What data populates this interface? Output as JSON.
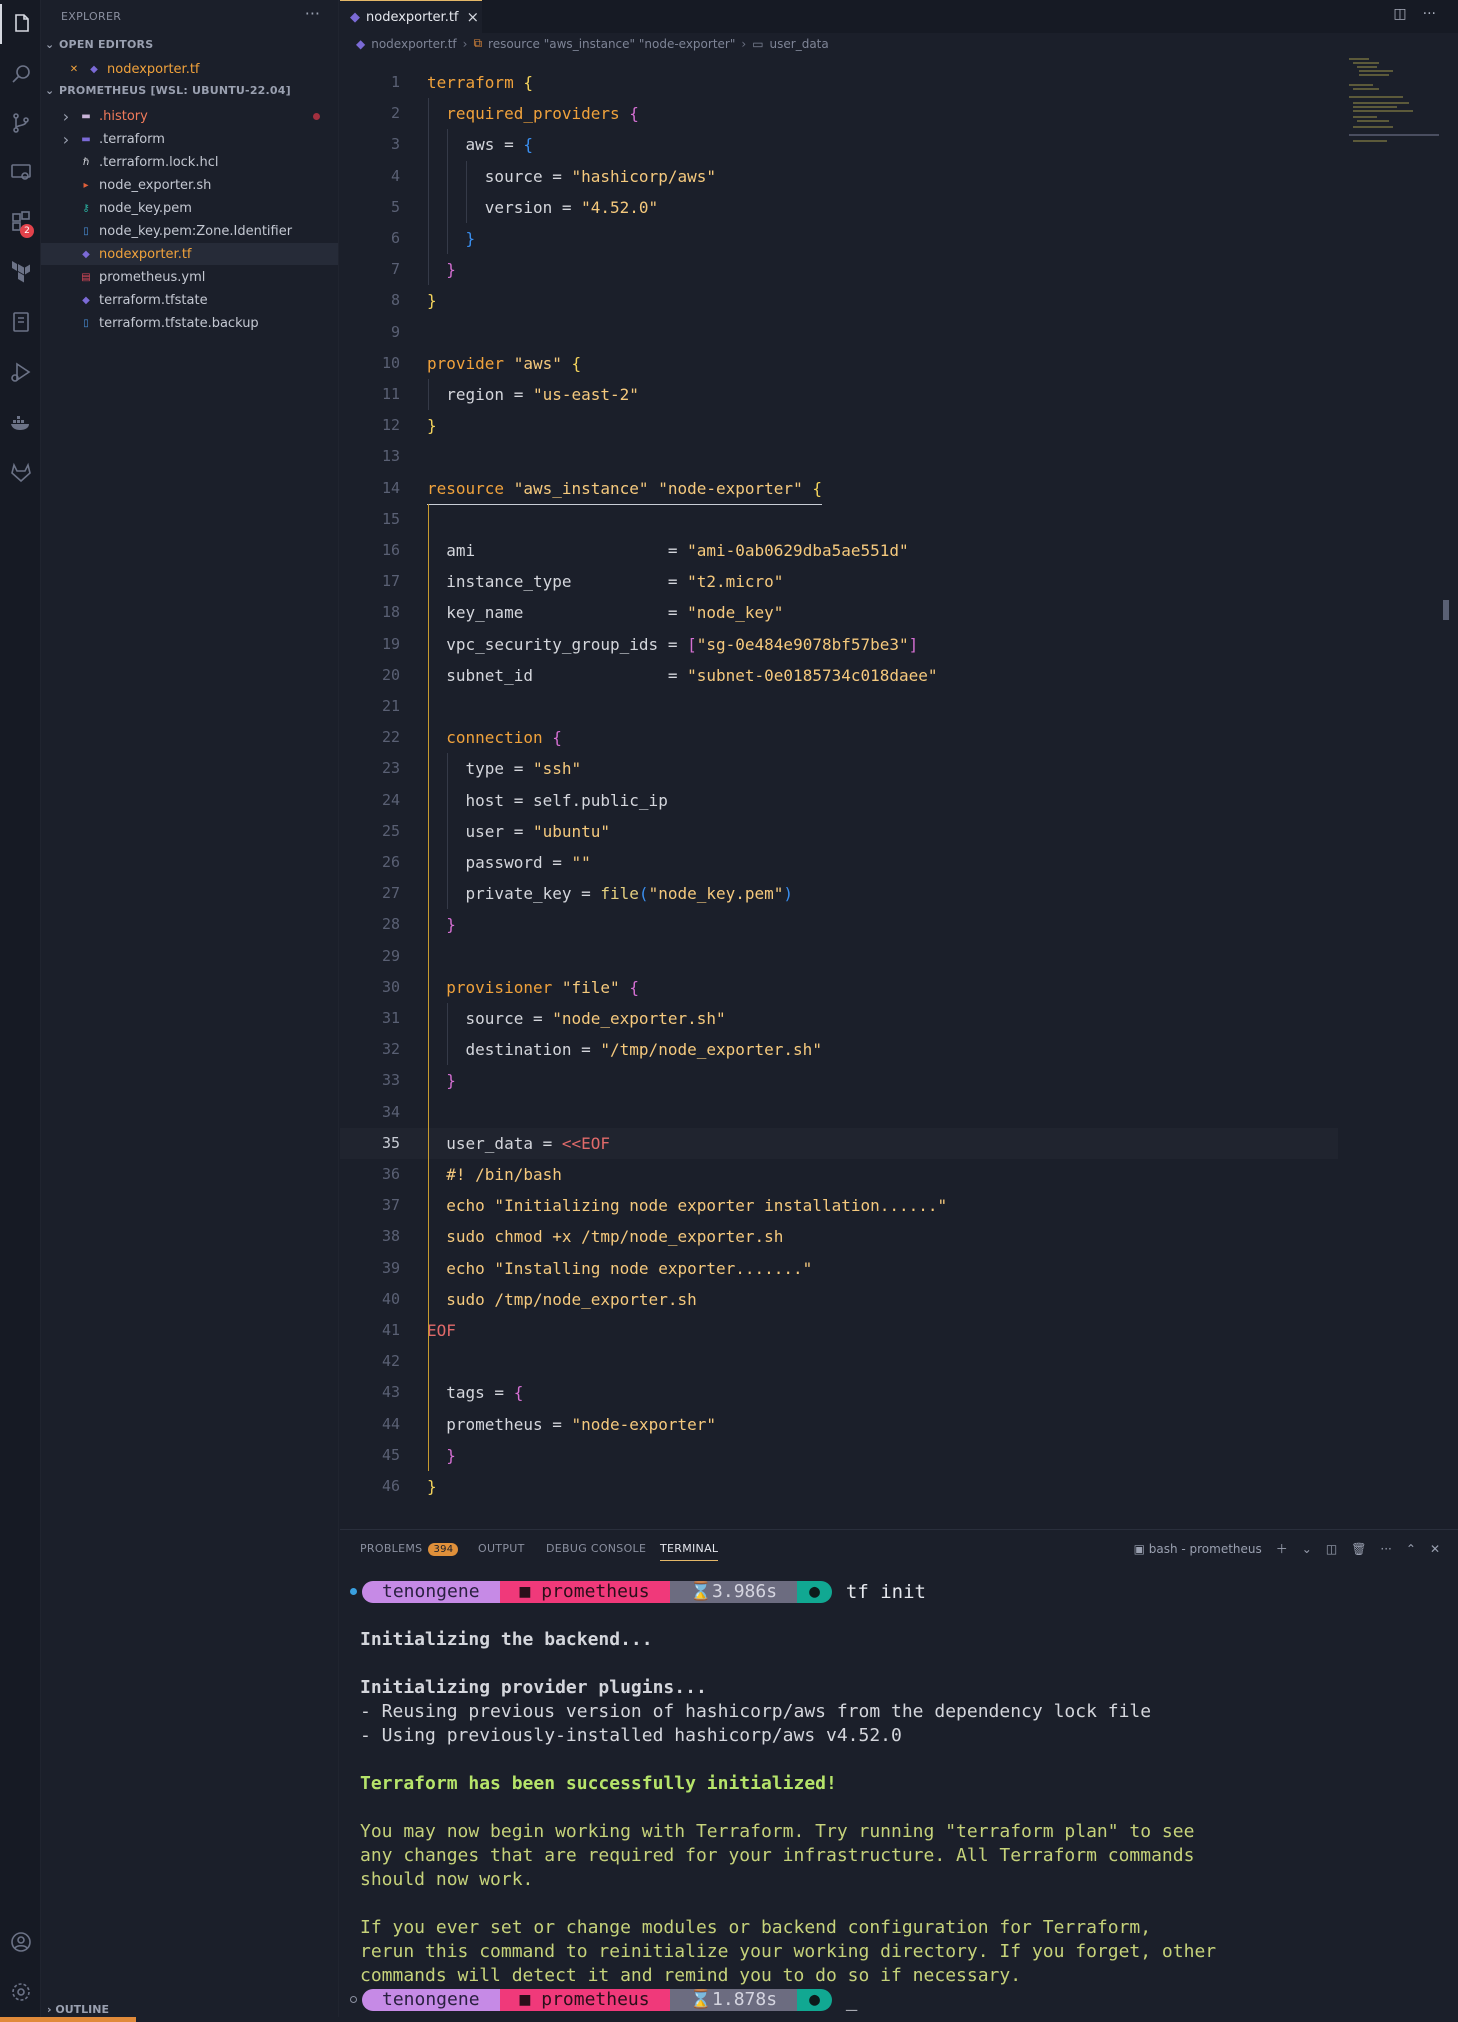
{
  "sidebar": {
    "title": "EXPLORER",
    "more": "···",
    "open_editors_label": "OPEN EDITORS",
    "open_editor_file": "nodexporter.tf",
    "project_label": "PROMETHEUS [WSL: UBUNTU-22.04]",
    "files": [
      {
        "name": ".history",
        "icon": "folder-icon",
        "color": "#f07a5a"
      },
      {
        "name": ".terraform",
        "icon": "terraform-folder-icon",
        "color": "#c4c8d2"
      },
      {
        "name": ".terraform.lock.hcl",
        "icon": "hcl-icon",
        "color": "#c4c8d2"
      },
      {
        "name": "node_exporter.sh",
        "icon": "shell-icon",
        "color": "#c4c8d2"
      },
      {
        "name": "node_key.pem",
        "icon": "key-icon",
        "color": "#c4c8d2"
      },
      {
        "name": "node_key.pem:Zone.Identifier",
        "icon": "file-icon",
        "color": "#c4c8d2"
      },
      {
        "name": "nodexporter.tf",
        "icon": "terraform-icon",
        "color": "#f0a23c"
      },
      {
        "name": "prometheus.yml",
        "icon": "yaml-icon",
        "color": "#c4c8d2"
      },
      {
        "name": "terraform.tfstate",
        "icon": "terraform-icon",
        "color": "#c4c8d2"
      },
      {
        "name": "terraform.tfstate.backup",
        "icon": "file-icon",
        "color": "#c4c8d2"
      }
    ],
    "outline_label": "OUTLINE"
  },
  "activity_bar": {
    "icons": [
      "files-icon",
      "search-icon",
      "source-control-icon",
      "remote-explorer-icon",
      "extensions-icon",
      "terraform-icon",
      "notebook-icon",
      "run-debug-icon",
      "docker-icon",
      "gitlab-icon"
    ],
    "extensions_badge": "2",
    "bottom_icons": [
      "account-icon",
      "settings-gear-icon"
    ]
  },
  "editor": {
    "tab_label": "nodexporter.tf",
    "breadcrumb": {
      "file": "nodexporter.tf",
      "resource": "resource \"aws_instance\" \"node-exporter\"",
      "field": "user_data"
    },
    "current_line": 35,
    "lines": [
      "terraform {",
      "  required_providers {",
      "    aws = {",
      "      source = \"hashicorp/aws\"",
      "      version = \"4.52.0\"",
      "    }",
      "  }",
      "}",
      "",
      "provider \"aws\" {",
      "  region = \"us-east-2\"",
      "}",
      "",
      "resource \"aws_instance\" \"node-exporter\" {",
      "",
      "  ami                    = \"ami-0ab0629dba5ae551d\"",
      "  instance_type          = \"t2.micro\"",
      "  key_name               = \"node_key\"",
      "  vpc_security_group_ids = [\"sg-0e484e9078bf57be3\"]",
      "  subnet_id              = \"subnet-0e0185734c018daee\"",
      "",
      "  connection {",
      "    type = \"ssh\"",
      "    host = self.public_ip",
      "    user = \"ubuntu\"",
      "    password = \"\"",
      "    private_key = file(\"node_key.pem\")",
      "  }",
      "",
      "  provisioner \"file\" {",
      "    source = \"node_exporter.sh\"",
      "    destination = \"/tmp/node_exporter.sh\"",
      "  }",
      "",
      "  user_data = <<EOF",
      "  #! /bin/bash",
      "  echo \"Initializing node exporter installation......\"",
      "  sudo chmod +x /tmp/node_exporter.sh",
      "  echo \"Installing node exporter.......\"",
      "  sudo /tmp/node_exporter.sh",
      "EOF",
      "",
      "  tags = {",
      "  prometheus = \"node-exporter\"",
      "  }",
      "}"
    ]
  },
  "panel": {
    "tabs": [
      {
        "label": "PROBLEMS",
        "count": "394"
      },
      {
        "label": "OUTPUT"
      },
      {
        "label": "DEBUG CONSOLE"
      },
      {
        "label": "TERMINAL",
        "active": true
      }
    ],
    "terminal_name": "bash - prometheus",
    "prompt": {
      "user": "tenongene",
      "dir": "prometheus",
      "time1": "3.986s",
      "time2": "1.878s",
      "command": "tf init"
    },
    "output": [
      {
        "text": "Initializing the backend...",
        "style": "b"
      },
      {
        "text": "",
        "style": ""
      },
      {
        "text": "Initializing provider plugins...",
        "style": "b"
      },
      {
        "text": "- Reusing previous version of hashicorp/aws from the dependency lock file",
        "style": ""
      },
      {
        "text": "- Using previously-installed hashicorp/aws v4.52.0",
        "style": ""
      },
      {
        "text": "",
        "style": ""
      },
      {
        "text": "Terraform has been successfully initialized!",
        "style": "g"
      },
      {
        "text": "",
        "style": ""
      },
      {
        "text": "You may now begin working with Terraform. Try running \"terraform plan\" to see",
        "style": "ye"
      },
      {
        "text": "any changes that are required for your infrastructure. All Terraform commands",
        "style": "ye"
      },
      {
        "text": "should now work.",
        "style": "ye"
      },
      {
        "text": "",
        "style": ""
      },
      {
        "text": "If you ever set or change modules or backend configuration for Terraform,",
        "style": "ye"
      },
      {
        "text": "rerun this command to reinitialize your working directory. If you forget, other",
        "style": "ye"
      },
      {
        "text": "commands will detect it and remind you to do so if necessary.",
        "style": "ye"
      }
    ],
    "cursor": "_"
  }
}
